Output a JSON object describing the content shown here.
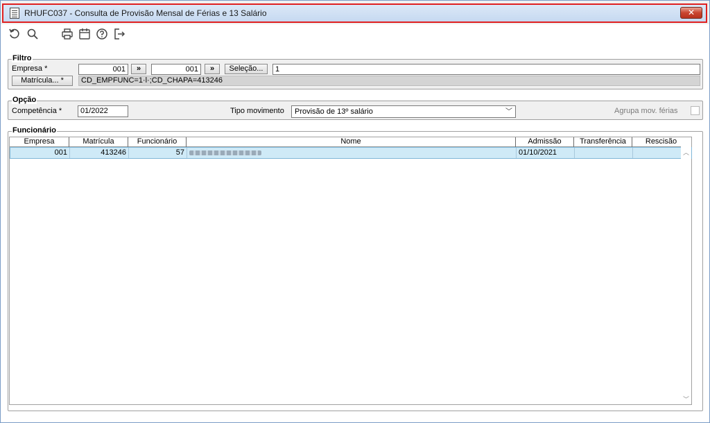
{
  "window": {
    "title": "RHUFC037 - Consulta de Provisão Mensal de Férias e 13 Salário",
    "close_label": "✕"
  },
  "toolbar": {
    "icons": [
      "refresh-icon",
      "search-icon",
      "print-icon",
      "calendar-icon",
      "help-icon",
      "exit-icon"
    ]
  },
  "filtro": {
    "group_label": "Filtro",
    "empresa_label": "Empresa *",
    "empresa_from": "001",
    "arrow1": "»",
    "empresa_to": "001",
    "arrow2": "»",
    "selecao_label": "Seleção...",
    "selecao_value": "1",
    "matricula_label": "Matrícula... *",
    "matricula_value": "CD_EMPFUNC=1·l·;CD_CHAPA=413246"
  },
  "opcao": {
    "group_label": "Opção",
    "competencia_label": "Competência *",
    "competencia_value": "01/2022",
    "tipo_label": "Tipo movimento",
    "tipo_value": "Provisão de 13º salário",
    "agrupa_label": "Agrupa mov. férias",
    "agrupa_checked": false
  },
  "funcionario": {
    "group_label": "Funcionário",
    "columns": [
      "Empresa",
      "Matrícula",
      "Funcionário",
      "Nome",
      "Admissão",
      "Transferência",
      "Rescisão"
    ],
    "rows": [
      {
        "empresa": "001",
        "matricula": "413246",
        "funcionario": "57",
        "nome": "",
        "admissao": "01/10/2021",
        "transferencia": "",
        "rescisao": ""
      }
    ]
  },
  "colors": {
    "title_border": "#e02020",
    "row_selected": "#cfeaf7",
    "close_button": "#c9452f"
  }
}
